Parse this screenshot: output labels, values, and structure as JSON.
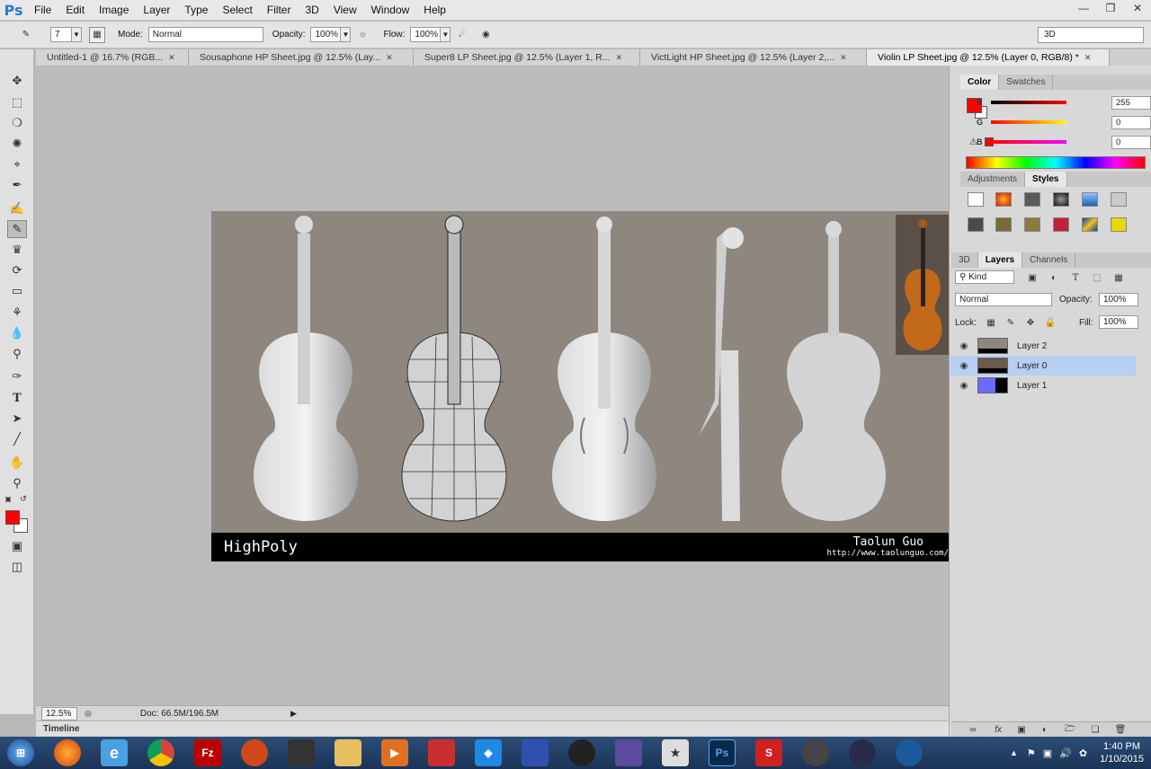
{
  "app": {
    "logo": "Ps"
  },
  "menu": [
    "File",
    "Edit",
    "Image",
    "Layer",
    "Type",
    "Select",
    "Filter",
    "3D",
    "View",
    "Window",
    "Help"
  ],
  "options": {
    "brush_size": "7",
    "mode_label": "Mode:",
    "mode_value": "Normal",
    "opacity_label": "Opacity:",
    "opacity_value": "100%",
    "flow_label": "Flow:",
    "flow_value": "100%",
    "workspace": "3D"
  },
  "tabs": [
    {
      "label": "Untitled-1 @ 16.7% (RGB..."
    },
    {
      "label": "Sousaphone HP Sheet.jpg @ 12.5% (Lay..."
    },
    {
      "label": "Super8 LP Sheet.jpg @ 12.5% (Layer 1, R..."
    },
    {
      "label": "VictLight HP Sheet.jpg @ 12.5% (Layer 2,..."
    },
    {
      "label": "Violin LP Sheet.jpg @ 12.5% (Layer 0, RGB/8) *"
    }
  ],
  "artwork": {
    "title": "HighPoly",
    "author": "Taolun Guo",
    "url": "http://www.taolunguo.com/"
  },
  "status": {
    "zoom": "12.5%",
    "doc": "Doc: 66.5M/196.5M"
  },
  "timeline_label": "Timeline",
  "color_panel": {
    "tabs": [
      "Color",
      "Swatches"
    ],
    "r_label": "R",
    "g_label": "G",
    "b_label": "B",
    "r": "255",
    "g": "0",
    "b": "0",
    "fg_color": "#ff0000"
  },
  "adjustments_panel": {
    "tabs": [
      "Adjustments",
      "Styles"
    ]
  },
  "layers_panel": {
    "tabs": [
      "3D",
      "Layers",
      "Channels"
    ],
    "filter": "Kind",
    "blend_mode": "Normal",
    "opacity_label": "Opacity:",
    "opacity": "100%",
    "lock_label": "Lock:",
    "fill_label": "Fill:",
    "fill": "100%",
    "layers": [
      {
        "name": "Layer 2",
        "selected": false
      },
      {
        "name": "Layer 0",
        "selected": true
      },
      {
        "name": "Layer 1",
        "selected": false
      }
    ]
  },
  "taskbar": {
    "time": "1:40 PM",
    "date": "1/10/2015",
    "apps": [
      "start",
      "firefox",
      "ie",
      "chrome",
      "filezilla",
      "app",
      "app",
      "explorer",
      "media",
      "app",
      "dropbox",
      "app",
      "app",
      "app",
      "zbrush",
      "photoshop",
      "substance",
      "app",
      "app",
      "app"
    ]
  }
}
